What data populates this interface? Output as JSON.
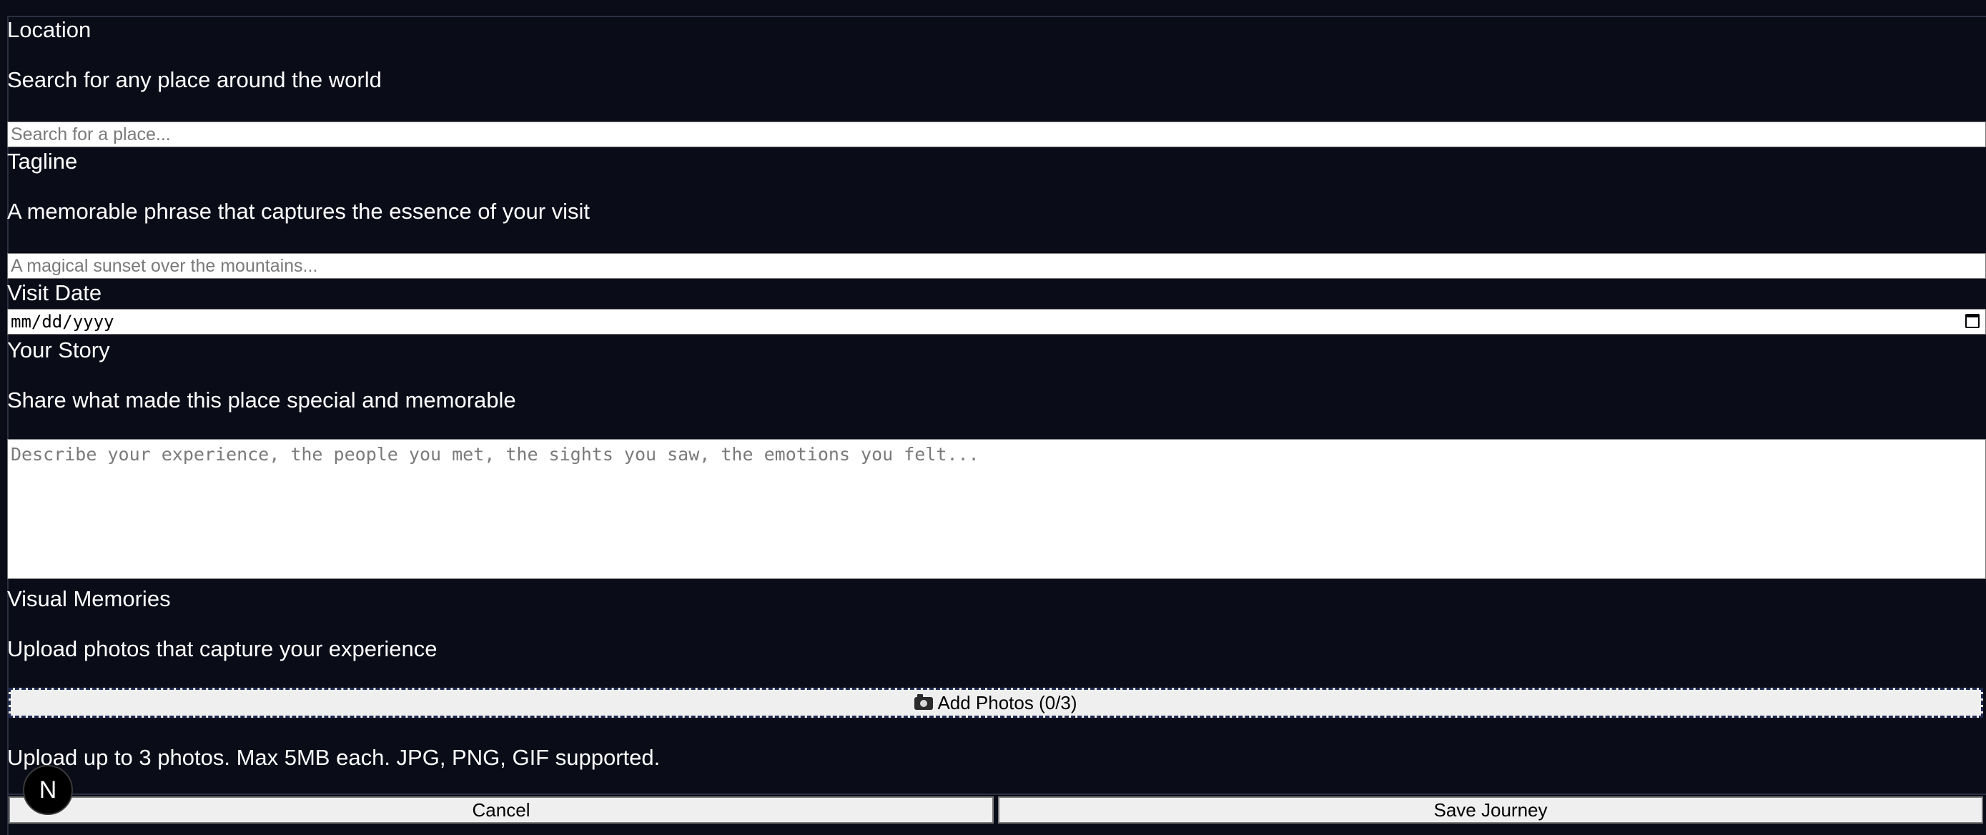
{
  "location": {
    "label": "Location",
    "description": "Search for any place around the world",
    "placeholder": "Search for a place..."
  },
  "tagline": {
    "label": "Tagline",
    "description": "A memorable phrase that captures the essence of your visit",
    "placeholder": "A magical sunset over the mountains..."
  },
  "visit_date": {
    "label": "Visit Date",
    "value_placeholder": "mm/dd/yyyy"
  },
  "story": {
    "label": "Your Story",
    "description": "Share what made this place special and memorable",
    "placeholder": "Describe your experience, the people you met, the sights you saw, the emotions you felt..."
  },
  "visual_memories": {
    "label": "Visual Memories",
    "description": "Upload photos that capture your experience",
    "add_button_label": "Add Photos (0/3)",
    "photo_count": 0,
    "photo_max": 3,
    "hint": "Upload up to 3 photos. Max 5MB each. JPG, PNG, GIF supported."
  },
  "actions": {
    "cancel_label": "Cancel",
    "save_label": "Save Journey"
  },
  "dev_badge": {
    "letter": "N"
  },
  "colors": {
    "background": "#0a0c18",
    "text": "#ffffff",
    "input_bg": "#ffffff",
    "button_bg": "#efefef",
    "dashed_border": "#1e2a50"
  }
}
